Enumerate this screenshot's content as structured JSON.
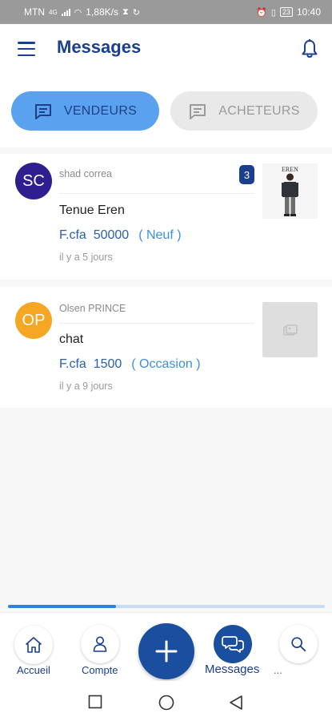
{
  "statusbar": {
    "carrier": "MTN",
    "net_type": "4G",
    "speed": "1,88K/s",
    "battery": "23",
    "time": "10:40"
  },
  "header": {
    "title": "Messages",
    "menu_icon": "hamburger-menu-icon",
    "notification_icon": "bell-icon"
  },
  "tabs": [
    {
      "label": "VENDEURS",
      "active": true,
      "icon": "chat-icon"
    },
    {
      "label": "ACHETEURS",
      "active": false,
      "icon": "chat-icon"
    }
  ],
  "conversations": [
    {
      "initials": "SC",
      "sender": "shad correa",
      "product": "Tenue Eren",
      "currency": "F.cfa",
      "price": "50000",
      "condition": "( Neuf )",
      "time_ago": "il y a 5 jours",
      "unread": "3",
      "avatar_color": "#2f1e8f",
      "thumb_text": "EREN"
    },
    {
      "initials": "OP",
      "sender": "Olsen PRINCE",
      "product": "chat",
      "currency": "F.cfa",
      "price": "1500",
      "condition": "( Occasion )",
      "time_ago": "il y a 9 jours",
      "unread": "",
      "avatar_color": "#f5a623"
    }
  ],
  "progress": 0.34,
  "bottom_nav": {
    "accueil": "Accueil",
    "compte": "Compte",
    "messages": "Messages",
    "more": "..."
  },
  "colors": {
    "primary": "#1a3f8f",
    "accent": "#5aa2f0",
    "price": "#2a5fb0"
  }
}
